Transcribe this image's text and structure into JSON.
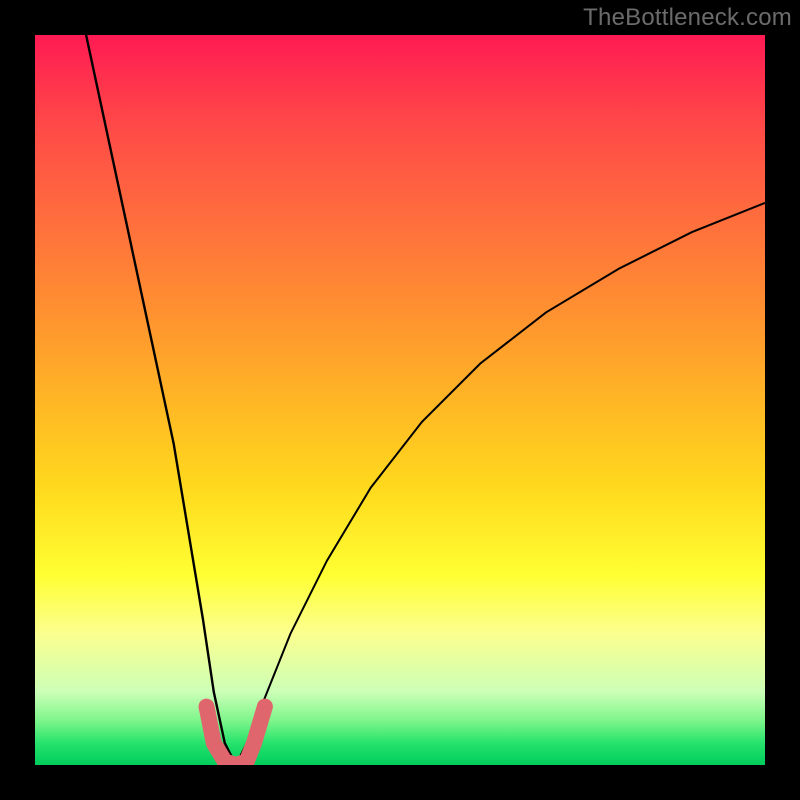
{
  "watermark": "TheBottleneck.com",
  "colors": {
    "background": "#000000",
    "accent_stroke": "#e0666e",
    "curve_stroke": "#000000",
    "gradient_top": "#ff1a53",
    "gradient_bottom": "#00cc5c"
  },
  "chart_data": {
    "type": "line",
    "title": "",
    "xlabel": "",
    "ylabel": "",
    "xlim": [
      0,
      100
    ],
    "ylim": [
      0,
      100
    ],
    "grid": false,
    "legend": false,
    "series": [
      {
        "name": "bottleneck-curve",
        "x": [
          7,
          10,
          13,
          16,
          19,
          21,
          23,
          24.5,
          26,
          27.5,
          29,
          31,
          35,
          40,
          46,
          53,
          61,
          70,
          80,
          90,
          100
        ],
        "y": [
          100,
          86,
          72,
          58,
          44,
          32,
          20,
          10,
          3,
          0,
          3,
          8,
          18,
          28,
          38,
          47,
          55,
          62,
          68,
          73,
          77
        ]
      },
      {
        "name": "highlight-trough",
        "x": [
          23.5,
          24.5,
          26,
          27.5,
          29,
          30,
          31.5
        ],
        "y": [
          8,
          3,
          0.5,
          0,
          0.5,
          3,
          8
        ]
      }
    ],
    "annotations": []
  }
}
